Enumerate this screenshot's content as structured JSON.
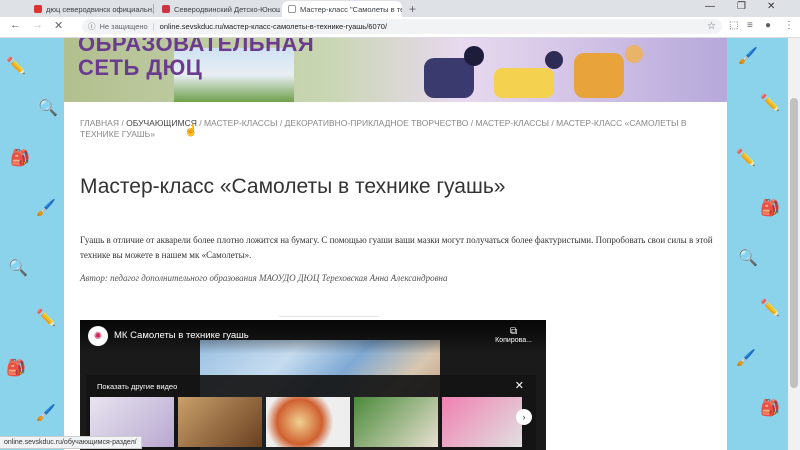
{
  "browser": {
    "tabs": [
      {
        "label": "дюц северодвинск официальн..."
      },
      {
        "label": "Северодвинский Детско-Юнош..."
      },
      {
        "label": "Мастер-класс \"Самолеты в тех..."
      }
    ],
    "security_label": "Не защищено",
    "url": "online.sevskduc.ru/мастер-класс-самолеты-в-технике-гуашь/6070/",
    "status_url": "online.sevskduc.ru/обучающимся-раздел/"
  },
  "banner": {
    "logo_line1": "ОБРАЗОВАТЕЛЬНАЯ",
    "logo_line2": "СЕТЬ ДЮЦ"
  },
  "breadcrumb": {
    "items": [
      "ГЛАВНАЯ",
      "ОБУЧАЮЩИМСЯ",
      "МАСТЕР-КЛАССЫ",
      "ДЕКОРАТИВНО-ПРИКЛАДНОЕ ТВОРЧЕСТВО",
      "МАСТЕР-КЛАССЫ",
      "МАСТЕР-КЛАСС «САМОЛЕТЫ В ТЕХНИКЕ ГУАШЬ»"
    ],
    "separator": " / "
  },
  "article": {
    "title": "Мастер-класс «Самолеты в технике гуашь»",
    "description": "Гуашь в отличие от акварели более плотно ложится на бумагу. С помощью гуаши ваши мазки могут получаться более фактуристыми. Попробовать свои силы в этой технике вы можете в нашем мк «Самолеты».",
    "author": "Автор: педагог дополнительного образования МАОУДО ДЮЦ Тереховская Анна Александровна"
  },
  "video": {
    "title": "МК Самолеты в технике гуашь",
    "copy_label": "Копирова...",
    "more_videos_label": "Показать другие видео"
  },
  "colors": {
    "page_bg": "#8ad3ea",
    "logo": "#6a3b8f",
    "breadcrumb_current": "#444444"
  }
}
